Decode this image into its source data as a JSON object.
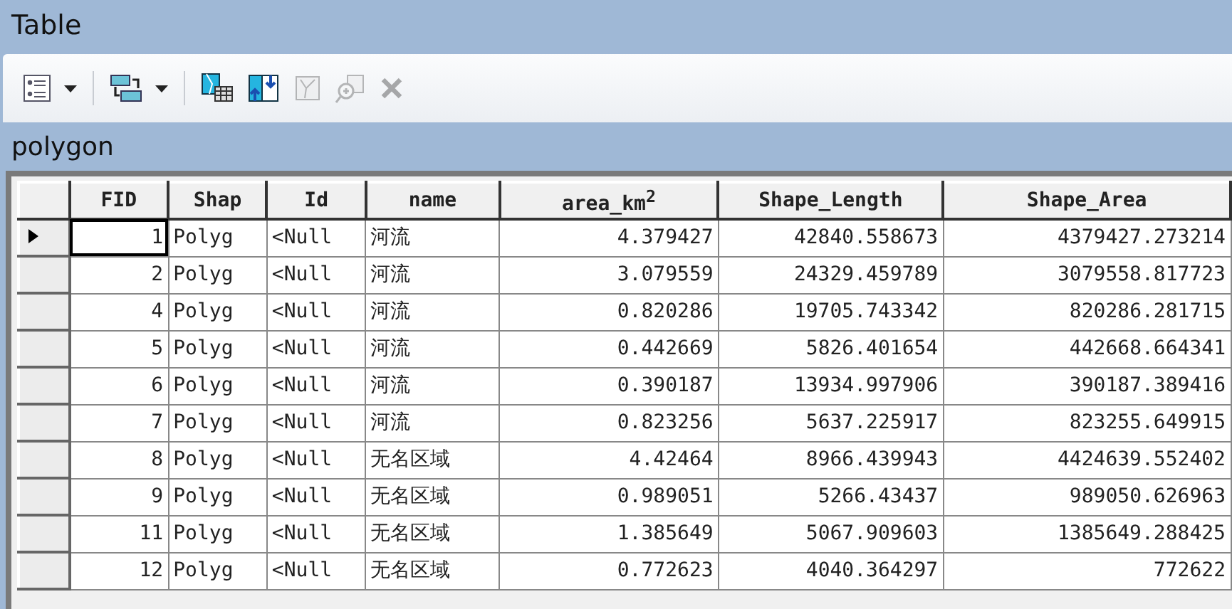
{
  "window": {
    "title": "Table"
  },
  "toolbar": [
    {
      "kind": "options",
      "dropdown": true,
      "disabled": false
    },
    {
      "kind": "related",
      "dropdown": true,
      "disabled": false
    },
    {
      "kind": "select",
      "disabled": false
    },
    {
      "kind": "switch",
      "disabled": false
    },
    {
      "kind": "clear",
      "disabled": true
    },
    {
      "kind": "zoom",
      "disabled": true
    },
    {
      "kind": "delete",
      "disabled": true
    }
  ],
  "tab": {
    "title": "polygon"
  },
  "table": {
    "columns": [
      "FID",
      "Shap",
      "Id",
      "name",
      "area_km$^{2}$",
      "Shape_Length",
      "Shape_Area"
    ],
    "rows": [
      {
        "selected": true,
        "cells": [
          "1",
          "Polyg",
          "<Null",
          "河流",
          "4.379427",
          "42840.558673",
          "4379427.273214"
        ]
      },
      {
        "selected": false,
        "cells": [
          "2",
          "Polyg",
          "<Null",
          "河流",
          "3.079559",
          "24329.459789",
          "3079558.817723"
        ]
      },
      {
        "selected": false,
        "cells": [
          "4",
          "Polyg",
          "<Null",
          "河流",
          "0.820286",
          "19705.743342",
          "820286.281715"
        ]
      },
      {
        "selected": false,
        "cells": [
          "5",
          "Polyg",
          "<Null",
          "河流",
          "0.442669",
          "5826.401654",
          "442668.664341"
        ]
      },
      {
        "selected": false,
        "cells": [
          "6",
          "Polyg",
          "<Null",
          "河流",
          "0.390187",
          "13934.997906",
          "390187.389416"
        ]
      },
      {
        "selected": false,
        "cells": [
          "7",
          "Polyg",
          "<Null",
          "河流",
          "0.823256",
          "5637.225917",
          "823255.649915"
        ]
      },
      {
        "selected": false,
        "cells": [
          "8",
          "Polyg",
          "<Null",
          "无名区域",
          "4.42464",
          "8966.439943",
          "4424639.552402"
        ]
      },
      {
        "selected": false,
        "cells": [
          "9",
          "Polyg",
          "<Null",
          "无名区域",
          "0.989051",
          "5266.43437",
          "989050.626963"
        ]
      },
      {
        "selected": false,
        "cells": [
          "11",
          "Polyg",
          "<Null",
          "无名区域",
          "1.385649",
          "5067.909603",
          "1385649.288425"
        ]
      },
      {
        "selected": false,
        "cells": [
          "12",
          "Polyg",
          "<Null",
          "无名区域",
          "0.772623",
          "4040.364297",
          "772622"
        ]
      }
    ]
  }
}
